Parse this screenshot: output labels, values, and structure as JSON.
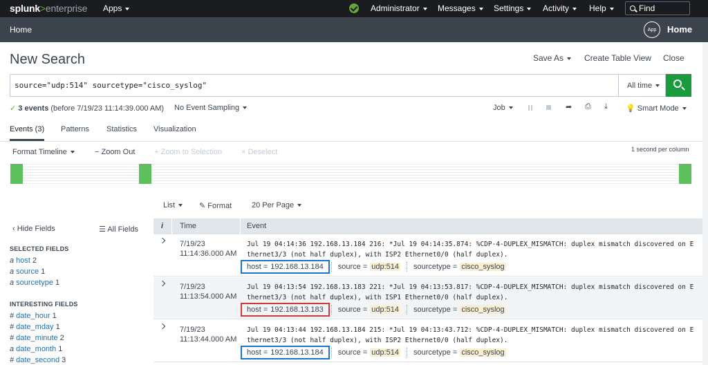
{
  "topnav": {
    "logo_brand": "splunk",
    "logo_gt": ">",
    "logo_product": "enterprise",
    "apps": "Apps",
    "user": "Administrator",
    "messages": "Messages",
    "settings": "Settings",
    "activity": "Activity",
    "help": "Help",
    "find_placeholder": "Find"
  },
  "appbar": {
    "home_link": "Home",
    "app_badge": "App",
    "app_title": "Home"
  },
  "search": {
    "title": "New Search",
    "save_as": "Save As",
    "create_table_view": "Create Table View",
    "close": "Close",
    "query": "source=\"udp:514\" sourcetype=\"cisco_syslog\"",
    "time_range": "All time",
    "status_check": "✓",
    "status_count": "3 events",
    "status_detail": "(before 7/19/23 11:14:39.000 AM)",
    "sampling": "No Event Sampling",
    "job": "Job",
    "mode": "Smart Mode"
  },
  "tabs": [
    {
      "label": "Events (3)"
    },
    {
      "label": "Patterns"
    },
    {
      "label": "Statistics"
    },
    {
      "label": "Visualization"
    }
  ],
  "timeline": {
    "format": "Format Timeline",
    "zoom_out": "− Zoom Out",
    "zoom_selection": "+ Zoom to Selection",
    "deselect": "× Deselect",
    "scale": "1 second per column"
  },
  "results": {
    "list": "List",
    "format": "Format",
    "per_page": "20 Per Page"
  },
  "sidebar": {
    "hide_fields": "Hide Fields",
    "all_fields": "All Fields",
    "selected_title": "SELECTED FIELDS",
    "selected": [
      {
        "type": "a",
        "name": "host",
        "count": "2"
      },
      {
        "type": "a",
        "name": "source",
        "count": "1"
      },
      {
        "type": "a",
        "name": "sourcetype",
        "count": "1"
      }
    ],
    "interesting_title": "INTERESTING FIELDS",
    "interesting": [
      {
        "type": "#",
        "name": "date_hour",
        "count": "1"
      },
      {
        "type": "#",
        "name": "date_mday",
        "count": "1"
      },
      {
        "type": "#",
        "name": "date_minute",
        "count": "2"
      },
      {
        "type": "a",
        "name": "date_month",
        "count": "1"
      },
      {
        "type": "#",
        "name": "date_second",
        "count": "3"
      }
    ]
  },
  "table": {
    "col_info": "i",
    "col_time": "Time",
    "col_event": "Event",
    "rows": [
      {
        "date": "7/19/23",
        "time": "11:14:36.000 AM",
        "raw": "Jul 19 04:14:36 192.168.13.184 216: *Jul 19 04:14:35.874: %CDP-4-DUPLEX_MISMATCH: duplex mismatch discovered on Ethernet3/3 (not half duplex), with ISP2 Ethernet0/0 (half duplex).",
        "host_key": "host =",
        "host": "192.168.13.184",
        "source_key": "source =",
        "source": "udp:514",
        "sourcetype_key": "sourcetype =",
        "sourcetype": "cisco_syslog"
      },
      {
        "date": "7/19/23",
        "time": "11:13:54.000 AM",
        "raw": "Jul 19 04:13:54 192.168.13.183 221: *Jul 19 04:13:53.817: %CDP-4-DUPLEX_MISMATCH: duplex mismatch discovered on Ethernet3/3 (not half duplex), with ISP1 Ethernet0/0 (half duplex).",
        "host_key": "host =",
        "host": "192.168.13.183",
        "source_key": "source =",
        "source": "udp:514",
        "sourcetype_key": "sourcetype =",
        "sourcetype": "cisco_syslog"
      },
      {
        "date": "7/19/23",
        "time": "11:13:44.000 AM",
        "raw": "Jul 19 04:13:44 192.168.13.184 215: *Jul 19 04:13:43.712: %CDP-4-DUPLEX_MISMATCH: duplex mismatch discovered on Ethernet3/3 (not half duplex), with ISP2 Ethernet0/0 (half duplex).",
        "host_key": "host =",
        "host": "192.168.13.184",
        "source_key": "source =",
        "source": "udp:514",
        "sourcetype_key": "sourcetype =",
        "sourcetype": "cisco_syslog"
      }
    ]
  },
  "colors": {
    "accent_green": "#65a637",
    "search_button": "#1a9c3e",
    "host_highlight_blue": "#1a73d1",
    "host_highlight_red": "#d0383a"
  }
}
